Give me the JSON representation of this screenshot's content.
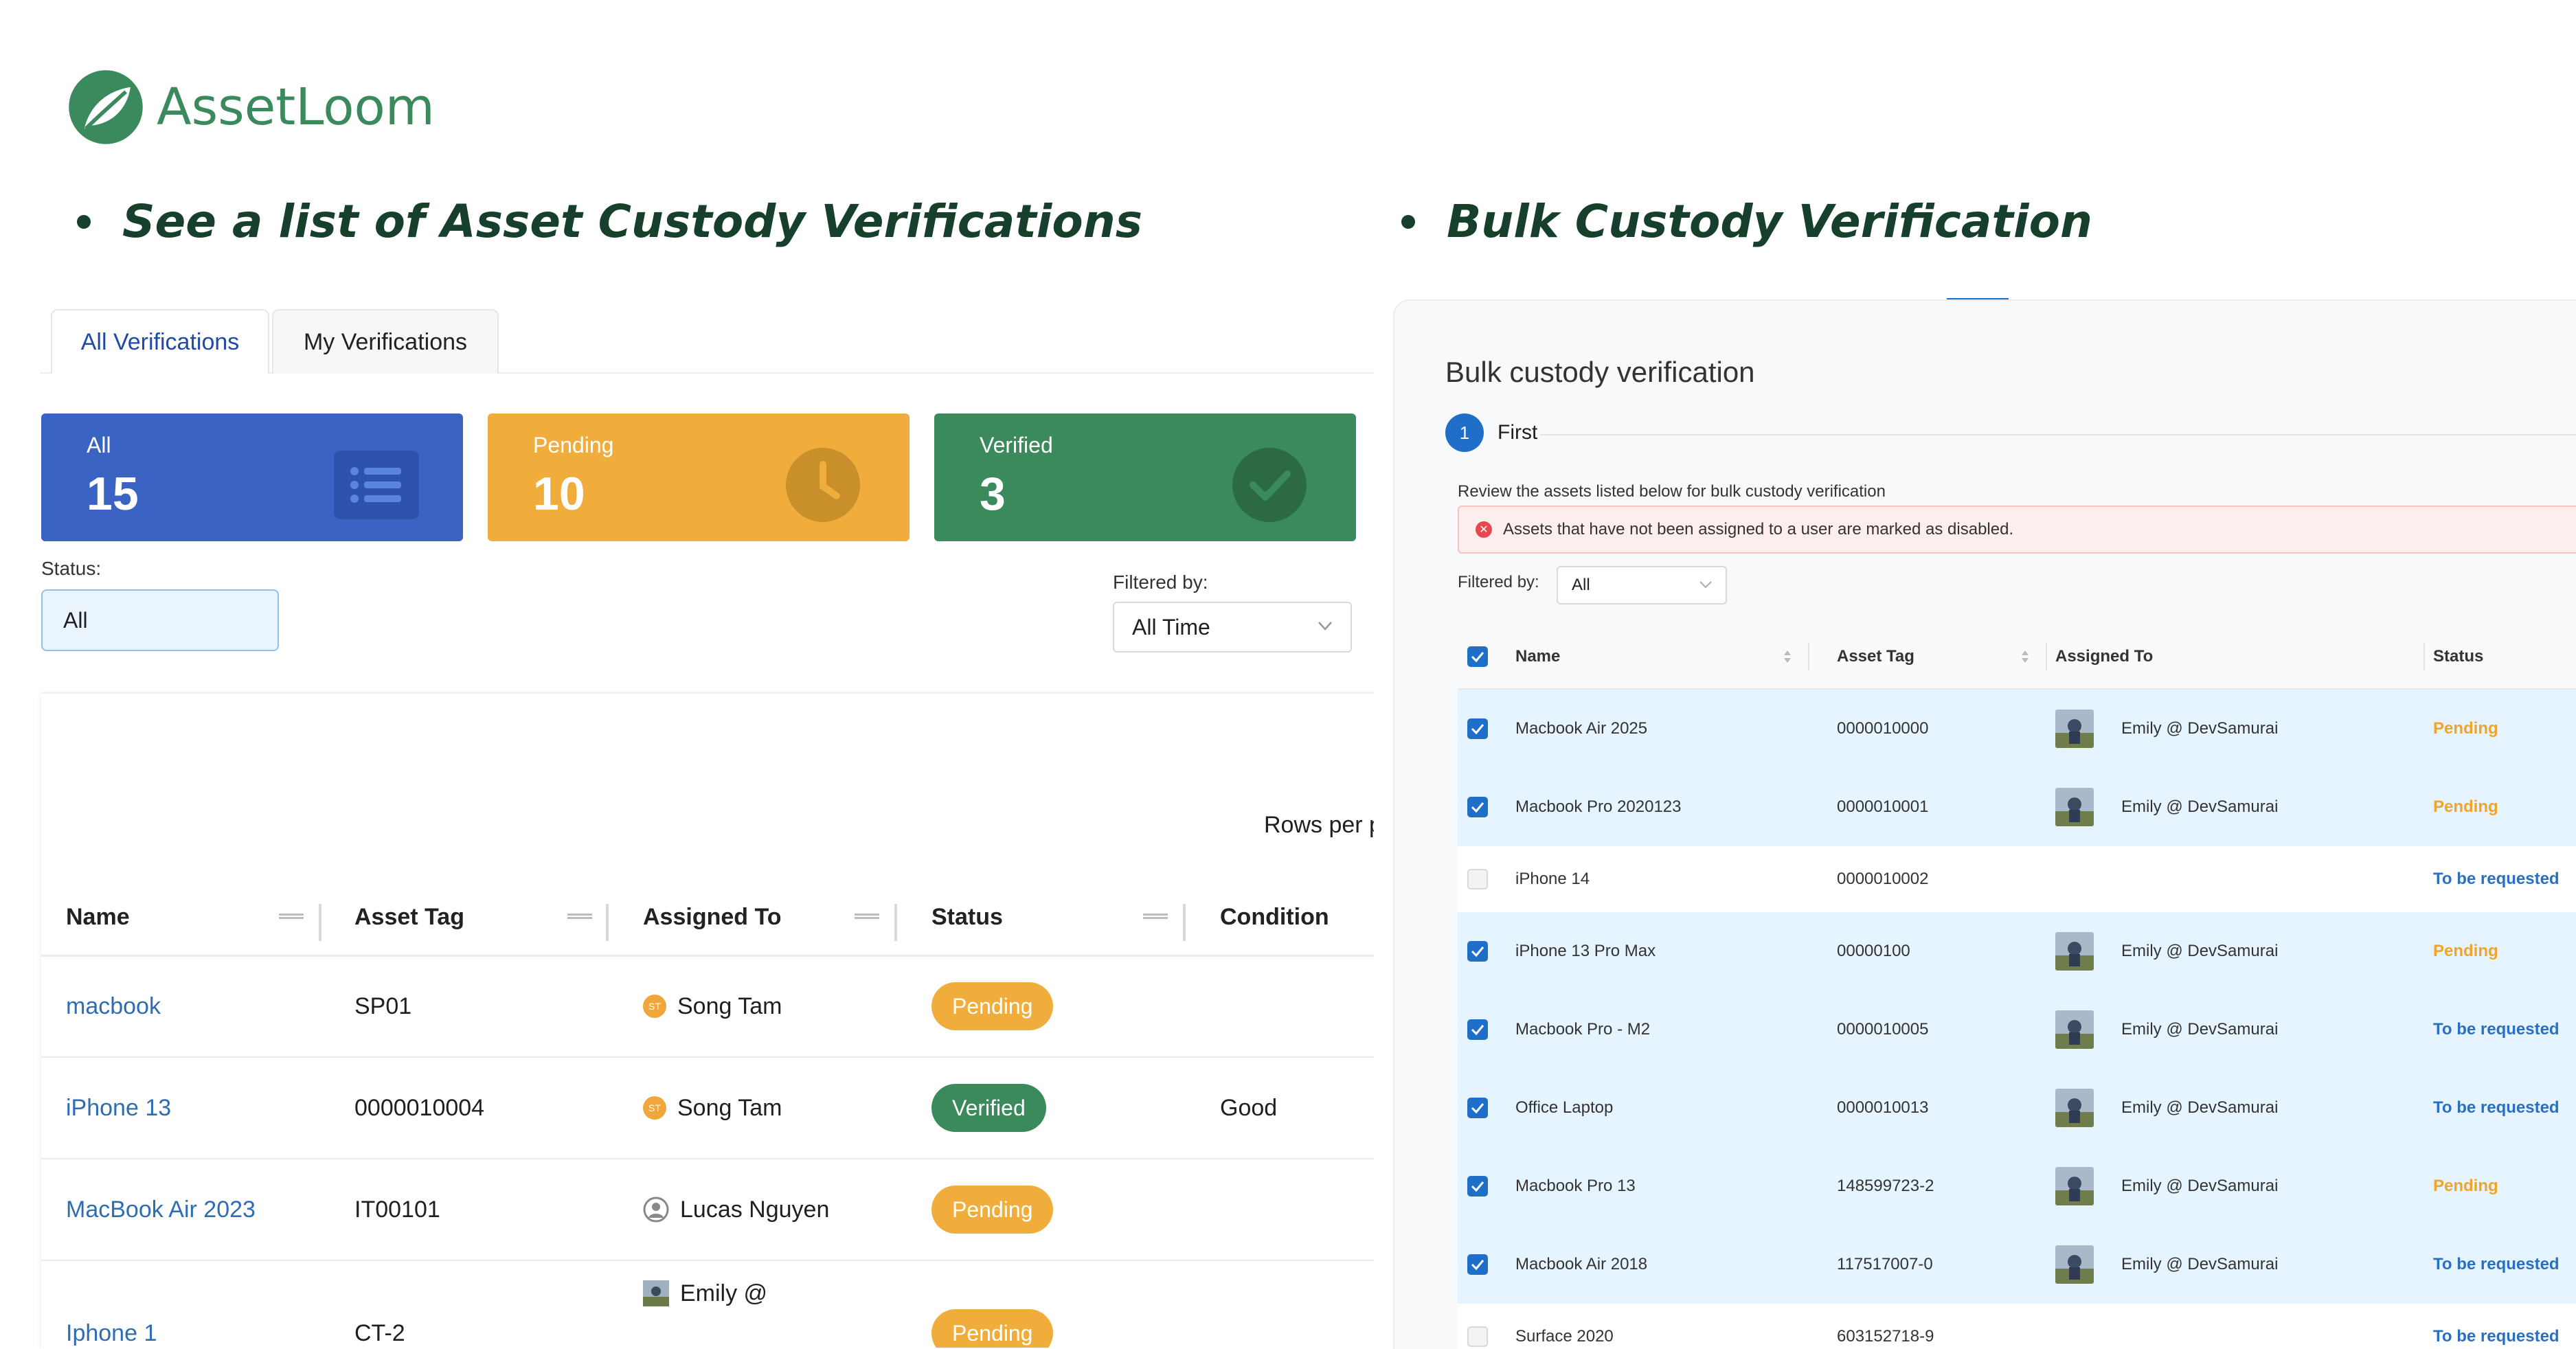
{
  "brand": {
    "name": "AssetLoom",
    "color": "#3b8a5e"
  },
  "headlines": {
    "left": "See a list of Asset Custody Verifications",
    "right": "Bulk Custody Verification"
  },
  "left": {
    "tabs": [
      {
        "label": "All Verifications",
        "active": true
      },
      {
        "label": "My Verifications",
        "active": false
      }
    ],
    "stats": [
      {
        "label": "All",
        "value": "15",
        "color": "#3b63c4",
        "icon": "list-icon"
      },
      {
        "label": "Pending",
        "value": "10",
        "color": "#f0ad3c",
        "icon": "clock-icon"
      },
      {
        "label": "Verified",
        "value": "3",
        "color": "#3a8a5b",
        "icon": "check-circle-icon"
      }
    ],
    "status_label": "Status:",
    "status_value": "All",
    "filtered_label": "Filtered by:",
    "filtered_value": "All Time",
    "rows_per_page": "Rows per p",
    "columns": [
      "Name",
      "Asset Tag",
      "Assigned To",
      "Status",
      "Condition"
    ],
    "rows": [
      {
        "name": "macbook",
        "tag": "SP01",
        "assignee": "Song Tam",
        "avatar": "ST",
        "status": "Pending",
        "condition": ""
      },
      {
        "name": "iPhone 13",
        "tag": "0000010004",
        "assignee": "Song Tam",
        "avatar": "ST",
        "status": "Verified",
        "condition": "Good"
      },
      {
        "name": "MacBook Air 2023",
        "tag": "IT00101",
        "assignee": "Lucas Nguyen",
        "avatar": "",
        "status": "Pending",
        "condition": ""
      },
      {
        "name": "Iphone 1",
        "tag": "CT-2",
        "assignee": "Emily @",
        "avatar": "",
        "status": "Pending",
        "condition": ""
      }
    ],
    "colors": {
      "pending": "#f0ad3c",
      "verified": "#3a8a5b",
      "link": "#2f6db3"
    }
  },
  "right": {
    "title": "Bulk custody verification",
    "step_number": "1",
    "step_label": "First",
    "review_text": "Review the assets listed below for bulk custody verification",
    "alert_text": "Assets that have not been assigned to a user are marked as disabled.",
    "filter_label": "Filtered by:",
    "filter_value": "All",
    "columns": [
      "Name",
      "Asset Tag",
      "Assigned To",
      "Status"
    ],
    "rows": [
      {
        "name": "Macbook Air 2025",
        "tag": "0000010000",
        "assignee": "Emily @ DevSamurai",
        "status": "Pending",
        "checked": true
      },
      {
        "name": "Macbook Pro 2020123",
        "tag": "0000010001",
        "assignee": "Emily @ DevSamurai",
        "status": "Pending",
        "checked": true
      },
      {
        "name": "iPhone 14",
        "tag": "0000010002",
        "assignee": "",
        "status": "To be requested",
        "checked": false
      },
      {
        "name": "iPhone 13 Pro Max",
        "tag": "00000100",
        "assignee": "Emily @ DevSamurai",
        "status": "Pending",
        "checked": true
      },
      {
        "name": "Macbook Pro - M2",
        "tag": "0000010005",
        "assignee": "Emily @ DevSamurai",
        "status": "To be requested",
        "checked": true
      },
      {
        "name": "Office Laptop",
        "tag": "0000010013",
        "assignee": "Emily @ DevSamurai",
        "status": "To be requested",
        "checked": true
      },
      {
        "name": "Macbook Pro 13",
        "tag": "148599723-2",
        "assignee": "Emily @ DevSamurai",
        "status": "Pending",
        "checked": true
      },
      {
        "name": "Macbook Air 2018",
        "tag": "117517007-0",
        "assignee": "Emily @ DevSamurai",
        "status": "To be requested",
        "checked": true
      },
      {
        "name": "Surface 2020",
        "tag": "603152718-9",
        "assignee": "",
        "status": "To be requested",
        "checked": false
      }
    ],
    "colors": {
      "pending": "#f0a52a",
      "requested": "#2a6fc0",
      "accent": "#1f6fc9"
    }
  }
}
